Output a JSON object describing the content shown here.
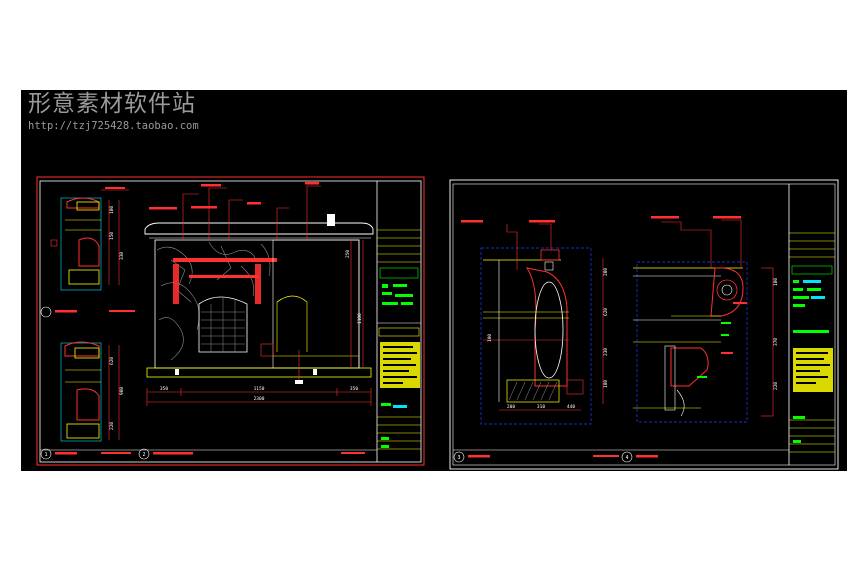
{
  "watermark": {
    "title": "形意素材软件站",
    "url": "http://tzj725428.taobao.com"
  },
  "colors": {
    "background": "#000000",
    "border_red": "#ff3030",
    "frame_white": "#ffffff",
    "cad_yellow": "#ffff00",
    "cad_green": "#00ff00",
    "cad_cyan": "#00e5ff",
    "cad_blue": "#2040ff",
    "cad_gray": "#8c8c8c"
  },
  "left_sheet": {
    "main_dims": {
      "total": "2300",
      "seg_a": "350",
      "seg_b": "1150",
      "seg_c": "350",
      "height_a": "1100",
      "height_b": "250"
    },
    "side_dims": [
      "100",
      "150",
      "330",
      "620",
      "900",
      "220"
    ],
    "footer_tags": [
      "1",
      "2"
    ]
  },
  "right_sheet": {
    "dims_left": [
      "200",
      "620",
      "230",
      "180",
      "100"
    ],
    "dims_right": [
      "100",
      "370",
      "220"
    ],
    "bottom_dims": [
      "200",
      "310",
      "440"
    ],
    "footer_tags": [
      "3",
      "4"
    ]
  }
}
